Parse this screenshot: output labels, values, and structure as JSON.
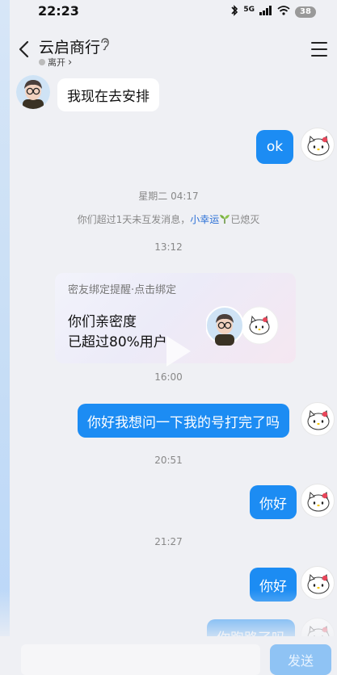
{
  "status_bar": {
    "time": "22:23",
    "network": "5G",
    "battery": "38"
  },
  "header": {
    "title": "云启商行",
    "status": "离开",
    "status_arrow": "›"
  },
  "messages": [
    {
      "side": "left",
      "text": "我现在去安排"
    },
    {
      "side": "right",
      "text": "ok"
    }
  ],
  "timestamps": {
    "t1": "星期二 04:17",
    "t2": "13:12",
    "t3": "16:00",
    "t4": "20:51",
    "t5": "21:27"
  },
  "system_notice": {
    "prefix": "你们超过1天未互发消息，",
    "link": "小幸运",
    "suffix": "已熄灭"
  },
  "card": {
    "header": "密友绑定提醒·点击绑定",
    "line1": "你们亲密度",
    "line2": "已超过80%用户"
  },
  "later_messages": [
    {
      "side": "right",
      "text": "你好我想问一下我的号打完了吗"
    },
    {
      "side": "right",
      "text": "你好"
    },
    {
      "side": "right",
      "text": "你好"
    },
    {
      "side": "right",
      "text": "你跑路了吗"
    }
  ],
  "composer": {
    "send_label": "发送"
  },
  "colors": {
    "bubble_right": "#1c8cf3",
    "bubble_left": "#ffffff",
    "send_disabled": "#8fc3f4"
  },
  "icons": [
    "back-icon",
    "ear-icon",
    "menu-icon",
    "play-icon"
  ]
}
